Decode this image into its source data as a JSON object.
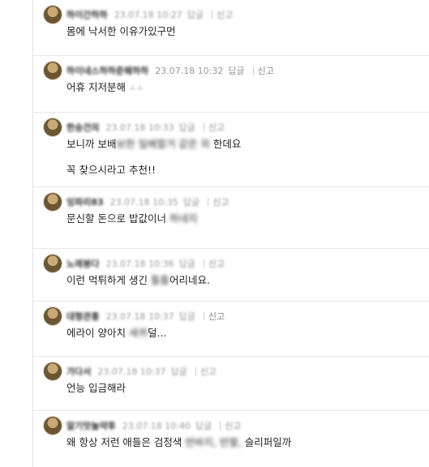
{
  "comments": [
    {
      "nick": "하이간하하",
      "date": "23.07.18 10:27",
      "reply": "답글",
      "report": "신고",
      "report_sharp": false,
      "text_a": "몸에 낙서한 이유가있구먼",
      "redacted": "",
      "text_b": "",
      "extra": ""
    },
    {
      "nick": "하이네스하하준웨하하",
      "date": "23.07.18 10:32",
      "reply": "답글",
      "report": "신고",
      "report_sharp": true,
      "text_a": "어휴 지저분해",
      "redacted": "ㅗㅗ",
      "text_b": "",
      "extra": ""
    },
    {
      "nick": "한승건의",
      "date": "23.07.18 10:33",
      "reply": "답글",
      "report": "신고",
      "report_sharp": false,
      "text_a": "보니까 보배",
      "redacted": "보한 일베할거 같은 외",
      "text_b": "한데요",
      "extra": "꼭 찾으시라고 추천!!"
    },
    {
      "nick": "잉파리83",
      "date": "23.07.18 10:35",
      "reply": "답글",
      "report": "신고",
      "report_sharp": false,
      "text_a": "문신할 돈으로 밥값이너",
      "redacted": "하네지",
      "text_b": "",
      "extra": ""
    },
    {
      "nick": "노래붕다",
      "date": "23.07.18 10:36",
      "reply": "답글",
      "report": "신고",
      "report_sharp": false,
      "text_a": "이런 먹튀하게 생긴 ",
      "redacted": "틀틀",
      "text_b": "어리네요.",
      "extra": ""
    },
    {
      "nick": "대형관흥",
      "date": "23.07.18 10:37",
      "reply": "답글",
      "report": "신고",
      "report_sharp": true,
      "text_a": "에라이 양아치 ",
      "redacted": "새퀴",
      "text_b": "덜...",
      "extra": ""
    },
    {
      "nick": "가다서",
      "date": "23.07.18 10:37",
      "reply": "답글",
      "report": "신고",
      "report_sharp": false,
      "text_a": "언능 입금해라",
      "redacted": "",
      "text_b": "",
      "extra": ""
    },
    {
      "nick": "알기맛놀약후",
      "date": "23.07.18 10:40",
      "reply": "답글",
      "report": "신고",
      "report_sharp": false,
      "text_a": "왜 항상 저런 애들은 검정색 ",
      "redacted": "반바지, 반팔,",
      "text_b": " 슬리퍼일까",
      "extra": ""
    }
  ]
}
